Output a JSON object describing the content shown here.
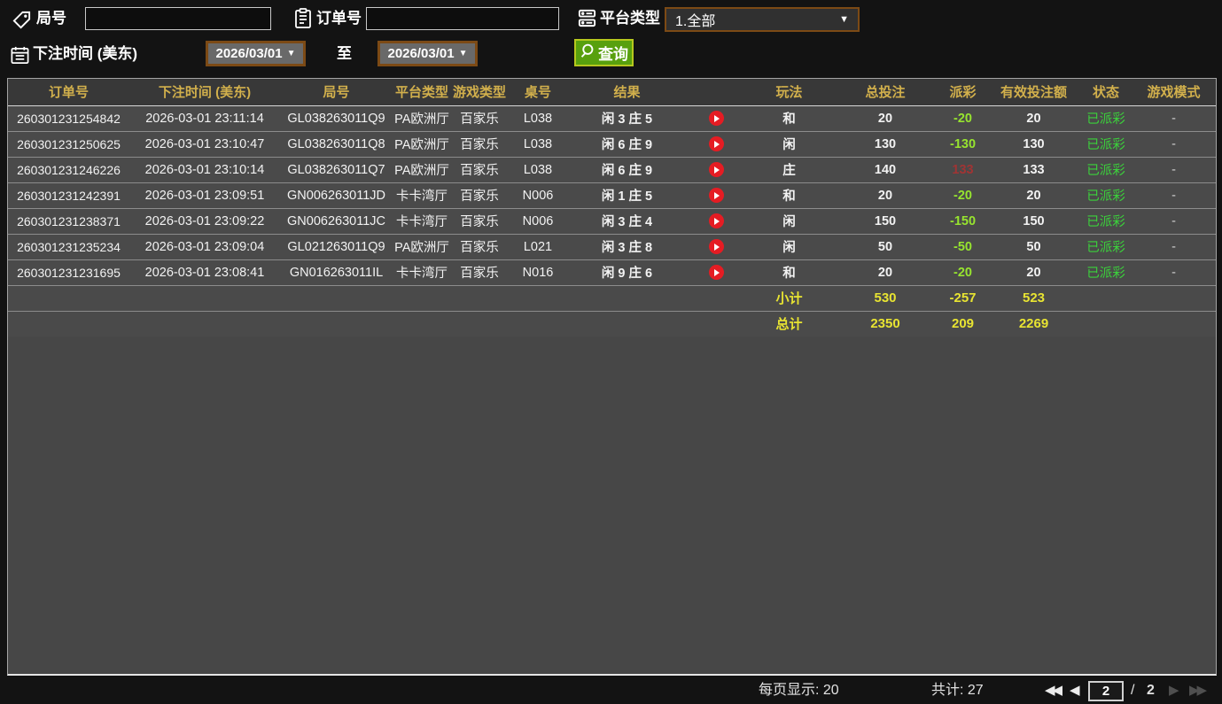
{
  "filters": {
    "round_no": {
      "label": "局号",
      "value": ""
    },
    "order_no": {
      "label": "订单号",
      "value": ""
    },
    "platform_type": {
      "label": "平台类型",
      "value": "1.全部"
    },
    "bet_time": {
      "label": "下注时间 (美东)",
      "from": "2026/03/01",
      "to_label": "至",
      "to": "2026/03/01"
    },
    "query_label": "查询"
  },
  "table": {
    "headers": [
      "订单号",
      "下注时间 (美东)",
      "局号",
      "平台类型",
      "游戏类型",
      "桌号",
      "结果",
      "",
      "玩法",
      "总投注",
      "派彩",
      "有效投注额",
      "状态",
      "游戏模式"
    ],
    "rows": [
      {
        "order_id": "260301231254842",
        "bet_time": "2026-03-01 23:11:14",
        "round_no": "GL038263011Q9",
        "platform": "PA欧洲厅",
        "game_type": "百家乐",
        "table_no": "L038",
        "result": "闲 3 庄 5",
        "play_way": "和",
        "total_bet": "20",
        "payout": "-20",
        "payout_state": "loss",
        "valid_bet": "20",
        "status": "已派彩",
        "mode": "-"
      },
      {
        "order_id": "260301231250625",
        "bet_time": "2026-03-01 23:10:47",
        "round_no": "GL038263011Q8",
        "platform": "PA欧洲厅",
        "game_type": "百家乐",
        "table_no": "L038",
        "result": "闲 6 庄 9",
        "play_way": "闲",
        "total_bet": "130",
        "payout": "-130",
        "payout_state": "loss",
        "valid_bet": "130",
        "status": "已派彩",
        "mode": "-"
      },
      {
        "order_id": "260301231246226",
        "bet_time": "2026-03-01 23:10:14",
        "round_no": "GL038263011Q7",
        "platform": "PA欧洲厅",
        "game_type": "百家乐",
        "table_no": "L038",
        "result": "闲 6 庄 9",
        "play_way": "庄",
        "total_bet": "140",
        "payout": "133",
        "payout_state": "win",
        "valid_bet": "133",
        "status": "已派彩",
        "mode": "-"
      },
      {
        "order_id": "260301231242391",
        "bet_time": "2026-03-01 23:09:51",
        "round_no": "GN006263011JD",
        "platform": "卡卡湾厅",
        "game_type": "百家乐",
        "table_no": "N006",
        "result": "闲 1 庄 5",
        "play_way": "和",
        "total_bet": "20",
        "payout": "-20",
        "payout_state": "loss",
        "valid_bet": "20",
        "status": "已派彩",
        "mode": "-"
      },
      {
        "order_id": "260301231238371",
        "bet_time": "2026-03-01 23:09:22",
        "round_no": "GN006263011JC",
        "platform": "卡卡湾厅",
        "game_type": "百家乐",
        "table_no": "N006",
        "result": "闲 3 庄 4",
        "play_way": "闲",
        "total_bet": "150",
        "payout": "-150",
        "payout_state": "loss",
        "valid_bet": "150",
        "status": "已派彩",
        "mode": "-"
      },
      {
        "order_id": "260301231235234",
        "bet_time": "2026-03-01 23:09:04",
        "round_no": "GL021263011Q9",
        "platform": "PA欧洲厅",
        "game_type": "百家乐",
        "table_no": "L021",
        "result": "闲 3 庄 8",
        "play_way": "闲",
        "total_bet": "50",
        "payout": "-50",
        "payout_state": "loss",
        "valid_bet": "50",
        "status": "已派彩",
        "mode": "-"
      },
      {
        "order_id": "260301231231695",
        "bet_time": "2026-03-01 23:08:41",
        "round_no": "GN016263011IL",
        "platform": "卡卡湾厅",
        "game_type": "百家乐",
        "table_no": "N016",
        "result": "闲 9 庄 6",
        "play_way": "和",
        "total_bet": "20",
        "payout": "-20",
        "payout_state": "loss",
        "valid_bet": "20",
        "status": "已派彩",
        "mode": "-"
      }
    ],
    "subtotal": {
      "label": "小计",
      "total_bet": "530",
      "payout": "-257",
      "valid_bet": "523"
    },
    "grand_total": {
      "label": "总计",
      "total_bet": "2350",
      "payout": "209",
      "valid_bet": "2269"
    }
  },
  "footer": {
    "per_page": "每页显示: 20",
    "total_count": "共计: 27",
    "first_arrow": "◀◀",
    "prev_arrow": "◀",
    "page_current": "2",
    "page_separator": "/",
    "page_total": "2",
    "next_arrow": "▶",
    "last_arrow": "▶▶"
  },
  "colors": {
    "header_text": "#d2b04c",
    "payout_loss": "#97e42f",
    "payout_win": "#a03434",
    "status_green": "#3bd23b",
    "summary_yellow": "#e8e432",
    "play_icon_red": "#e51c23",
    "query_button_green": "#58a00e",
    "date_border_brown": "#7c4a15"
  }
}
